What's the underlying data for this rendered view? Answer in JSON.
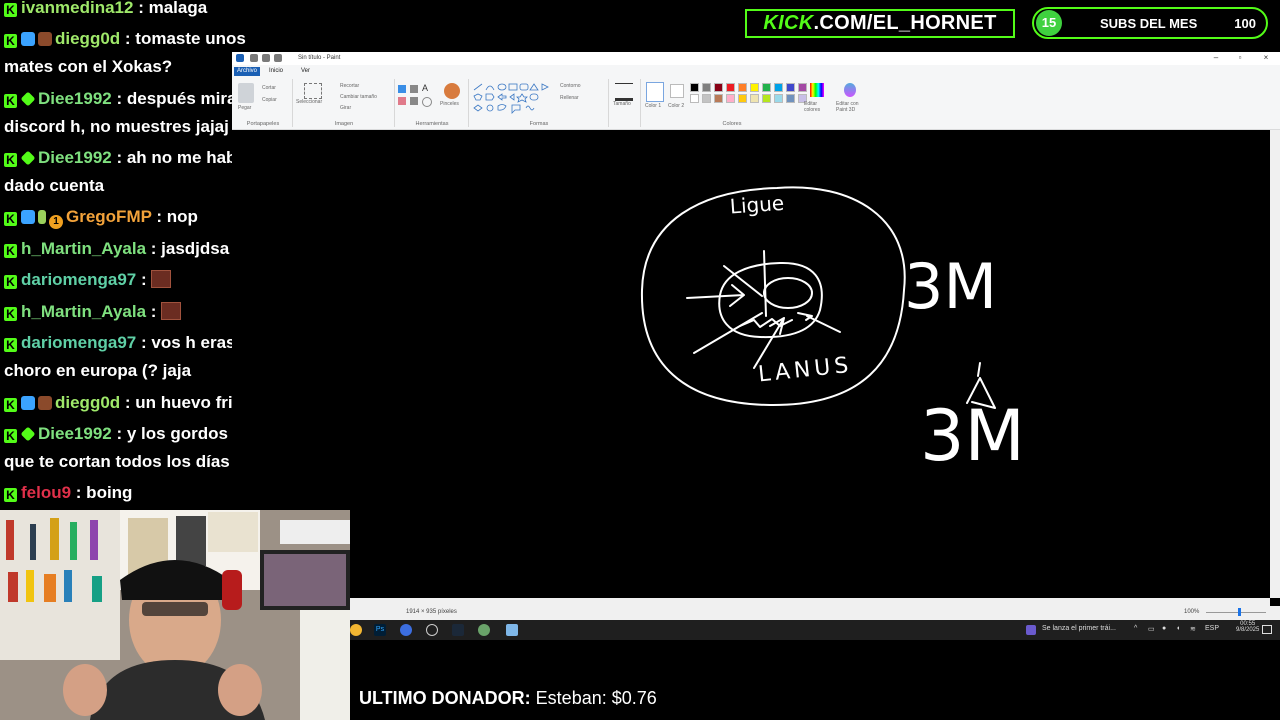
{
  "chat": {
    "messages": [
      {
        "user": "ivanmedina12",
        "text": ": malaga"
      },
      {
        "user": "diegg0d",
        "text": ": tomaste unos",
        "cont": "mates con el Xokas?"
      },
      {
        "user": "Diee1992",
        "text": ": después mira",
        "cont": "discord h, no muestres jajaj"
      },
      {
        "user": "Diee1992",
        "text": ": ah no me había",
        "cont": "dado cuenta"
      },
      {
        "user": "GregoFMP",
        "text": ": nop"
      },
      {
        "user": "h_Martin_Ayala",
        "text": ": jasdjdsa"
      },
      {
        "user": "dariomenga97",
        "text": ":"
      },
      {
        "user": "h_Martin_Ayala",
        "text": ":"
      },
      {
        "user": "dariomenga97",
        "text": ": vos h eras el",
        "cont": "choro en europa (? jaja"
      },
      {
        "user": "diegg0d",
        "text": ": un huevo frito"
      },
      {
        "user": "Diee1992",
        "text": ": y los gordos cgt",
        "cont": "que te cortan todos los días"
      },
      {
        "user": "felou9",
        "text": ": boing"
      }
    ]
  },
  "paint": {
    "title": "Sin título - Paint",
    "menu": [
      "Archivo",
      "Inicio",
      "Ver"
    ],
    "ribbon": {
      "clipboard": {
        "paste": "Pegar",
        "cut": "Cortar",
        "copy": "Copiar",
        "label": "Portapapeles"
      },
      "image": {
        "select": "Seleccionar",
        "crop": "Recortar",
        "resize": "Cambiar tamaño",
        "rotate": "Girar",
        "label": "Imagen"
      },
      "tools": {
        "label": "Herramientas",
        "brushes": "Pinceles"
      },
      "shapes": {
        "outline": "Contorno",
        "fill": "Rellenar",
        "label": "Formas"
      },
      "size": "Tamaño",
      "color1": "Color 1",
      "color2": "Color 2",
      "colors_label": "Colores",
      "edit_colors": "Editar colores",
      "paint3d": "Editar con Paint 3D"
    },
    "palette": [
      "#000000",
      "#7f7f7f",
      "#880015",
      "#ed1c24",
      "#ff7f27",
      "#fff200",
      "#22b14c",
      "#00a2e8",
      "#3f48cc",
      "#a349a4",
      "#ffffff",
      "#c3c3c3",
      "#b97a57",
      "#ffaec9",
      "#ffc90e",
      "#efe4b0",
      "#b5e61d",
      "#99d9ea",
      "#7092be",
      "#c8bfe7"
    ],
    "drawing": {
      "top_text": "Ligue",
      "bottom_text": "LANUS",
      "right_text_1": "3M",
      "right_text_2": "3M"
    },
    "status": {
      "dimensions": "1914 × 935 píxeles",
      "zoom": "100%"
    }
  },
  "taskbar": {
    "tray_text": "Se lanza el primer trái...",
    "lang": "ESP",
    "time": "00:55",
    "date": "9/8/2025"
  },
  "overlay": {
    "kick_brand": "KICK",
    "kick_url": ".COM/EL_HORNET",
    "subs_count": "15",
    "subs_label": "SUBS DEL MES",
    "subs_goal": "100",
    "donor_label": "ULTIMO DONADOR:",
    "donor_value": "Esteban: $0.76"
  }
}
